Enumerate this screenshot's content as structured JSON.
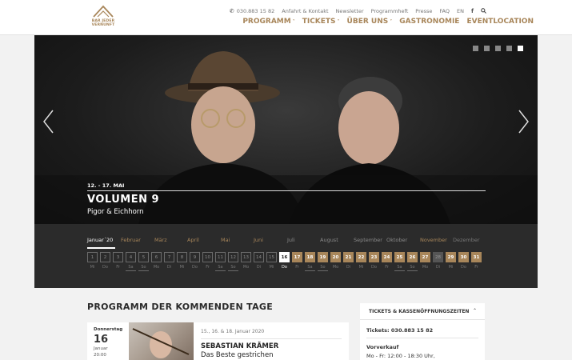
{
  "logo": {
    "line1": "BAR JEDER",
    "line2": "VERNUNFT"
  },
  "topnav": {
    "phone_icon": "phone-icon",
    "phone": "030.883 15 82",
    "items": [
      "Anfahrt & Kontakt",
      "Newsletter",
      "Programmheft",
      "Presse",
      "FAQ",
      "EN"
    ],
    "facebook": "f",
    "search_icon": "search-icon"
  },
  "mainnav": [
    {
      "label": "PROGRAMM",
      "dropdown": true
    },
    {
      "label": "TICKETS",
      "dropdown": true
    },
    {
      "label": "ÜBER UNS",
      "dropdown": true
    },
    {
      "label": "GASTRONOMIE",
      "dropdown": false
    },
    {
      "label": "EVENTLOCATION",
      "dropdown": false
    }
  ],
  "hero": {
    "date": "12. - 17. MAI",
    "title": "VOLUMEN 9",
    "subtitle": "Pigor & Eichhorn",
    "slide_count": 5,
    "active_slide": 4
  },
  "calendar": {
    "months": [
      {
        "label": "Januar´20",
        "state": "active"
      },
      {
        "label": "Februar",
        "state": "avail"
      },
      {
        "label": "März",
        "state": "avail"
      },
      {
        "label": "April",
        "state": "avail"
      },
      {
        "label": "Mai",
        "state": "avail"
      },
      {
        "label": "Juni",
        "state": "avail"
      },
      {
        "label": "Juli",
        "state": "future"
      },
      {
        "label": "August",
        "state": "future"
      },
      {
        "label": "September",
        "state": "future"
      },
      {
        "label": "Oktober",
        "state": "future"
      },
      {
        "label": "November",
        "state": "avail"
      },
      {
        "label": "Dezember",
        "state": "dim"
      }
    ],
    "days": [
      {
        "n": "1",
        "wd": "Mi",
        "s": "past"
      },
      {
        "n": "2",
        "wd": "Do",
        "s": "past"
      },
      {
        "n": "3",
        "wd": "Fr",
        "s": "past"
      },
      {
        "n": "4",
        "wd": "Sa",
        "s": "past"
      },
      {
        "n": "5",
        "wd": "So",
        "s": "past"
      },
      {
        "n": "6",
        "wd": "Mo",
        "s": "past"
      },
      {
        "n": "7",
        "wd": "Di",
        "s": "past"
      },
      {
        "n": "8",
        "wd": "Mi",
        "s": "past"
      },
      {
        "n": "9",
        "wd": "Do",
        "s": "past"
      },
      {
        "n": "10",
        "wd": "Fr",
        "s": "past"
      },
      {
        "n": "11",
        "wd": "Sa",
        "s": "past"
      },
      {
        "n": "12",
        "wd": "So",
        "s": "past"
      },
      {
        "n": "13",
        "wd": "Mo",
        "s": "past"
      },
      {
        "n": "14",
        "wd": "Di",
        "s": "past"
      },
      {
        "n": "15",
        "wd": "Mi",
        "s": "past"
      },
      {
        "n": "16",
        "wd": "Do",
        "s": "today"
      },
      {
        "n": "17",
        "wd": "Fr",
        "s": "avail"
      },
      {
        "n": "18",
        "wd": "Sa",
        "s": "avail"
      },
      {
        "n": "19",
        "wd": "So",
        "s": "avail"
      },
      {
        "n": "20",
        "wd": "Mo",
        "s": "avail"
      },
      {
        "n": "21",
        "wd": "Di",
        "s": "avail"
      },
      {
        "n": "22",
        "wd": "Mi",
        "s": "avail"
      },
      {
        "n": "23",
        "wd": "Do",
        "s": "avail"
      },
      {
        "n": "24",
        "wd": "Fr",
        "s": "avail"
      },
      {
        "n": "25",
        "wd": "Sa",
        "s": "avail"
      },
      {
        "n": "26",
        "wd": "So",
        "s": "avail"
      },
      {
        "n": "27",
        "wd": "Mo",
        "s": "avail"
      },
      {
        "n": "28",
        "wd": "Di",
        "s": "sold"
      },
      {
        "n": "29",
        "wd": "Mi",
        "s": "avail"
      },
      {
        "n": "30",
        "wd": "Do",
        "s": "avail"
      },
      {
        "n": "31",
        "wd": "Fr",
        "s": "avail"
      }
    ]
  },
  "program": {
    "heading": "PROGRAMM DER KOMMENDEN TAGE",
    "event": {
      "dow": "Donnerstag",
      "day": "16",
      "month": "Januar",
      "time": "20:00",
      "dates": "15., 16. & 18. Januar 2020",
      "artist": "SEBASTIAN KRÄMER",
      "show": "Das Beste gestrichen"
    }
  },
  "tickets": {
    "heading": "TICKETS & KASSENÖFFNUNGSZEITEN",
    "phone": "Tickets: 030.883 15 82",
    "presale_label": "Vorverkauf",
    "hours": "Mo - Fr: 12:00 - 18:30 Uhr,"
  },
  "colors": {
    "accent": "#a8865a",
    "hero_bg": "#1a1a1a",
    "calendar_bg": "#2b2b2b",
    "page_bg": "#f2f2f2"
  }
}
